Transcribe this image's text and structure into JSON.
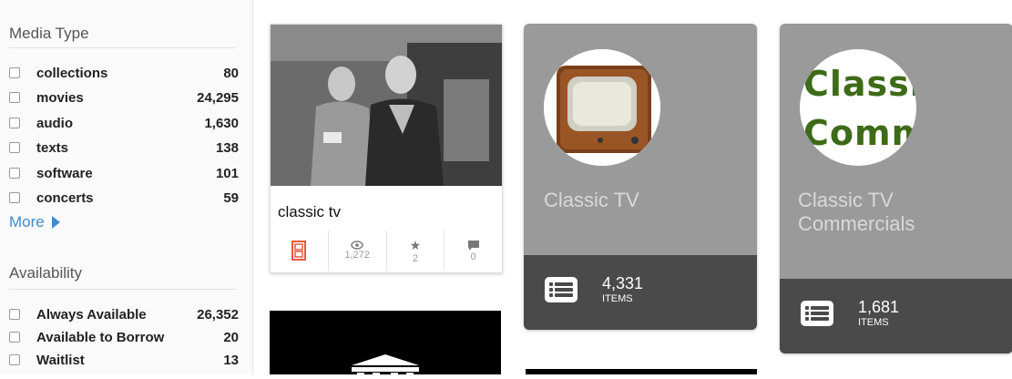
{
  "sidebar": {
    "media_type": {
      "title": "Media Type",
      "items": [
        {
          "label": "collections",
          "count": "80"
        },
        {
          "label": "movies",
          "count": "24,295"
        },
        {
          "label": "audio",
          "count": "1,630"
        },
        {
          "label": "texts",
          "count": "138"
        },
        {
          "label": "software",
          "count": "101"
        },
        {
          "label": "concerts",
          "count": "59"
        }
      ],
      "more": "More"
    },
    "availability": {
      "title": "Availability",
      "items": [
        {
          "label": "Always Available",
          "count": "26,352"
        },
        {
          "label": "Available to Borrow",
          "count": "20"
        },
        {
          "label": "Waitlist",
          "count": "13"
        }
      ]
    }
  },
  "results": {
    "item1": {
      "title": "classic tv",
      "views": "1,272",
      "favorites": "2",
      "reviews": "0",
      "type_icon": "film-icon"
    },
    "coll1": {
      "title": "Classic TV",
      "count": "4,331",
      "count_label": "ITEMS"
    },
    "coll2": {
      "title_line1": "Classic TV",
      "title_line2": "Commercials",
      "count": "1,681",
      "count_label": "ITEMS",
      "logo_text_1": "Classi",
      "logo_text_2": "Comm"
    }
  },
  "colors": {
    "accent_link": "#428bca",
    "film_icon": "#e8573f",
    "collection_bg": "#9a9a9a",
    "collection_footer": "#4a4a4a"
  }
}
